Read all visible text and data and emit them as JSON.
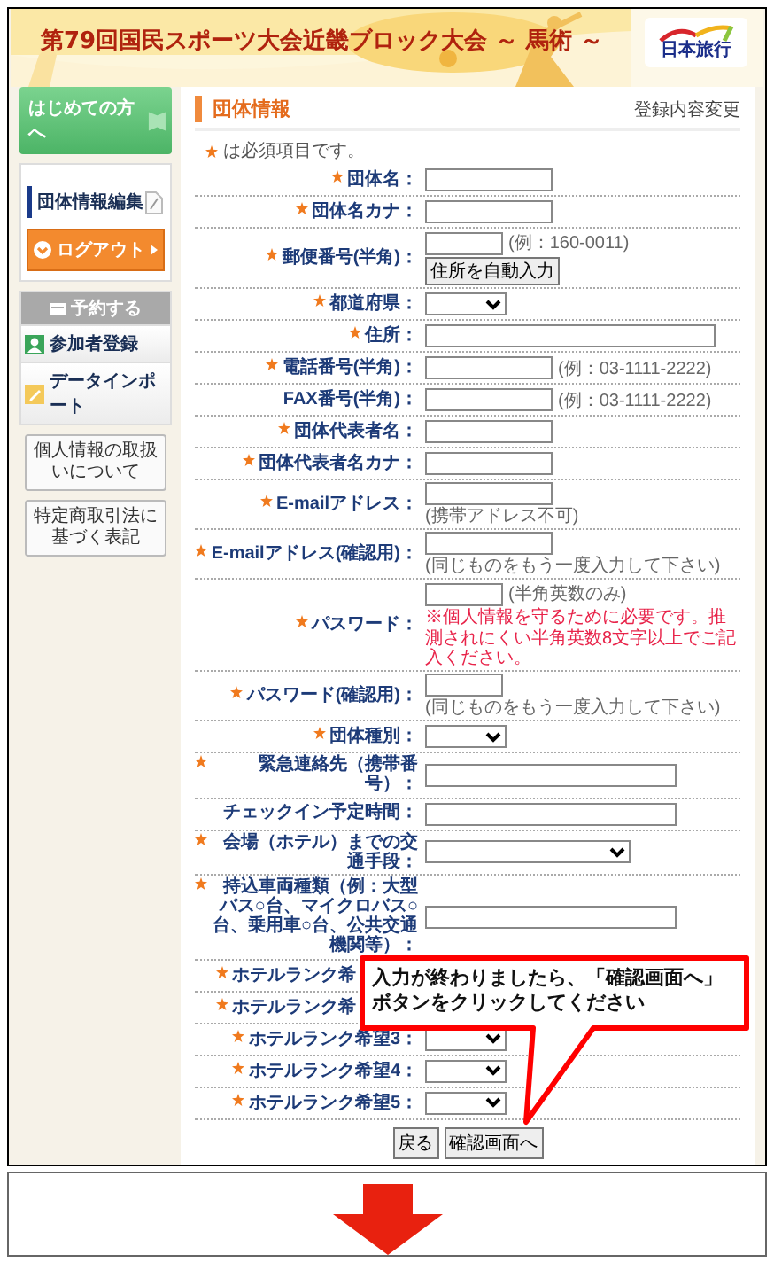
{
  "header": {
    "title": "第79回国民スポーツ大会近畿ブロック大会 ～ 馬術 ～",
    "logo": "日本旅行"
  },
  "sidebar": {
    "first_visit": "はじめての方へ",
    "edit": "団体情報編集",
    "logout": "ログアウト",
    "section": {
      "title": "予約する",
      "items": [
        {
          "label": "参加者登録",
          "kind": "person"
        },
        {
          "label": "データインポート",
          "kind": "pencil"
        }
      ]
    },
    "links": [
      "個人情報の取扱いについて",
      "特定商取引法に基づく表記"
    ]
  },
  "main": {
    "heading": "団体情報",
    "side_link": "登録内容変更",
    "required_note": "は必須項目です。",
    "rows": [
      {
        "label": "団体名：",
        "required": true,
        "kind": "input"
      },
      {
        "label": "団体名カナ：",
        "required": true,
        "kind": "input"
      },
      {
        "label": "郵便番号(半角)：",
        "required": true,
        "kind": "short-input",
        "note": "(例：160-0011)",
        "button": "住所を自動入力"
      },
      {
        "label": "都道府県：",
        "required": true,
        "kind": "select"
      },
      {
        "label": "住所：",
        "required": true,
        "kind": "long-input"
      },
      {
        "label": "電話番号(半角)：",
        "required": true,
        "kind": "input",
        "note": "(例：03-1111-2222)"
      },
      {
        "label": "FAX番号(半角)：",
        "required": false,
        "kind": "input",
        "note": "(例：03-1111-2222)"
      },
      {
        "label": "団体代表者名：",
        "required": true,
        "kind": "input"
      },
      {
        "label": "団体代表者名カナ：",
        "required": true,
        "kind": "input"
      },
      {
        "label": "E-mailアドレス：",
        "required": true,
        "kind": "input",
        "sub": "(携帯アドレス不可)"
      },
      {
        "label": "E-mailアドレス(確認用)：",
        "required": true,
        "kind": "input",
        "sub": "(同じものをもう一度入力して下さい)"
      },
      {
        "label": "パスワード：",
        "required": true,
        "kind": "short-input",
        "note": "(半角英数のみ)",
        "warning": "※個人情報を守るために必要です。推測されにくい半角英数8文字以上でご記入ください。"
      },
      {
        "label": "パスワード(確認用)：",
        "required": true,
        "kind": "short-input",
        "sub": "(同じものをもう一度入力して下さい)"
      },
      {
        "label": "団体種別：",
        "required": true,
        "kind": "select"
      },
      {
        "label": "緊急連絡先（携帯番号）：",
        "required": true,
        "kind": "mid-input"
      },
      {
        "label": "チェックイン予定時間：",
        "required": false,
        "kind": "mid-input"
      },
      {
        "label": "会場（ホテル）までの交通手段：",
        "required": true,
        "kind": "long-select"
      },
      {
        "label": "持込車両種類（例：大型バス○台、マイクロバス○台、乗用車○台、公共交通機関等）：",
        "required": true,
        "kind": "mid-input"
      },
      {
        "label": "ホテルランク希",
        "required": true
      },
      {
        "label": "ホテルランク希",
        "required": true
      },
      {
        "label": "ホテルランク希望3：",
        "required": true,
        "kind": "select"
      },
      {
        "label": "ホテルランク希望4：",
        "required": true,
        "kind": "select"
      },
      {
        "label": "ホテルランク希望5：",
        "required": true,
        "kind": "select"
      }
    ],
    "buttons": [
      "戻る",
      "確認画面へ"
    ]
  },
  "callout": "入力が終わりましたら、「確認画面へ」ボタンをクリックしてください"
}
